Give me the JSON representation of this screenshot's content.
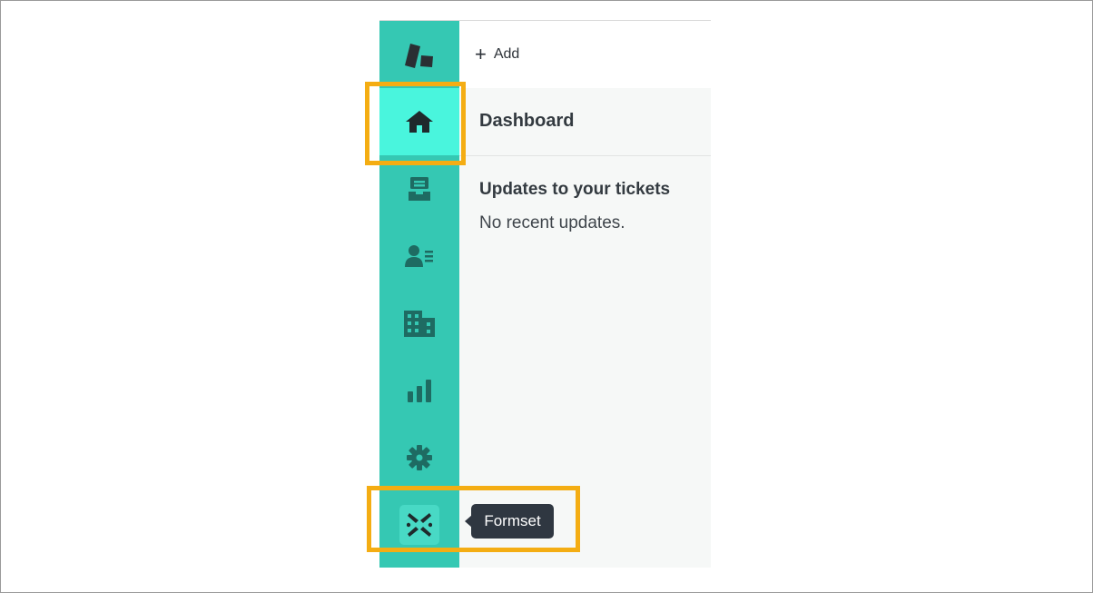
{
  "topbar": {
    "add_label": "Add",
    "add_icon": "plus-icon"
  },
  "sidebar": {
    "logo_icon": "app-logo",
    "items": [
      {
        "icon": "home-icon",
        "active": true
      },
      {
        "icon": "inbox-icon",
        "active": false
      },
      {
        "icon": "contacts-icon",
        "active": false
      },
      {
        "icon": "building-icon",
        "active": false
      },
      {
        "icon": "bar-chart-icon",
        "active": false
      },
      {
        "icon": "gear-icon",
        "active": false
      },
      {
        "icon": "formset-icon",
        "active": false
      }
    ]
  },
  "main": {
    "page_title": "Dashboard",
    "section_title": "Updates to your tickets",
    "section_body": "No recent updates."
  },
  "tooltip": {
    "label": "Formset"
  },
  "colors": {
    "sidebar_bg": "#35c8b3",
    "active_item_bg": "#49f5dd",
    "highlight_border": "#f4ad13",
    "tooltip_bg": "#2f3741"
  }
}
